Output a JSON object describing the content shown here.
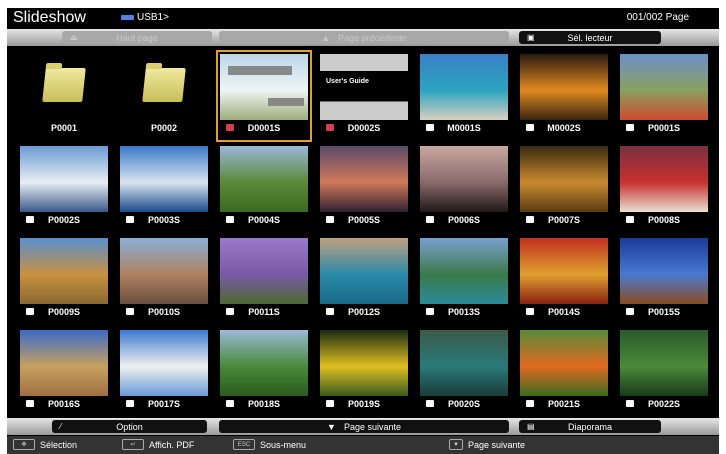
{
  "header": {
    "title": "Slideshow",
    "path": "USB1>",
    "page": "001/002 Page"
  },
  "top_toolbar": {
    "top_page": "Haut page",
    "prev_page": "Page précédente",
    "select_reader": "Sél. lecteur"
  },
  "bottom_toolbar": {
    "option": "Option",
    "next_page": "Page suivante",
    "slideshow": "Diaporama"
  },
  "hints": [
    {
      "key": "✥",
      "label": "Sélection"
    },
    {
      "key": "↵",
      "label": "Affich. PDF"
    },
    {
      "key": "ESC",
      "label": "Sous-menu"
    },
    {
      "key": "▼",
      "label": "Page suivante"
    }
  ],
  "pdf_thumb_text": "User's Guide",
  "selected": "D0001S",
  "tiles": [
    {
      "name": "P0001",
      "type": "folder"
    },
    {
      "name": "P0002",
      "type": "folder"
    },
    {
      "name": "D0001S",
      "type": "pdf",
      "colors": [
        "#bcd6ea",
        "#eef3f5",
        "#9eae7a"
      ]
    },
    {
      "name": "D0002S",
      "type": "pdf2"
    },
    {
      "name": "M0001S",
      "type": "movie",
      "colors": [
        "#3b7fc6",
        "#2aa5c0",
        "#d8d0c0"
      ]
    },
    {
      "name": "M0002S",
      "type": "movie",
      "colors": [
        "#2a1a10",
        "#e08a20",
        "#3a2410"
      ]
    },
    {
      "name": "P0001S",
      "type": "photo",
      "colors": [
        "#6a90c8",
        "#8aa060",
        "#d04a30"
      ]
    },
    {
      "name": "P0002S",
      "type": "photo",
      "colors": [
        "#6a9ad0",
        "#e8eef4",
        "#3a5a8a"
      ]
    },
    {
      "name": "P0003S",
      "type": "photo",
      "colors": [
        "#3a78c8",
        "#d8e4f0",
        "#1a4a8a"
      ]
    },
    {
      "name": "P0004S",
      "type": "photo",
      "colors": [
        "#9ab8d8",
        "#5a8a3a",
        "#3a6a20"
      ]
    },
    {
      "name": "P0005S",
      "type": "photo",
      "colors": [
        "#5a4a6a",
        "#d07a5a",
        "#302030"
      ]
    },
    {
      "name": "P0006S",
      "type": "photo",
      "colors": [
        "#c8a8a0",
        "#8a6a6a",
        "#201818"
      ]
    },
    {
      "name": "P0007S",
      "type": "photo",
      "colors": [
        "#3a2a10",
        "#c88a30",
        "#5a3a10"
      ]
    },
    {
      "name": "P0008S",
      "type": "photo",
      "colors": [
        "#7a3040",
        "#c83030",
        "#e8e0d0"
      ]
    },
    {
      "name": "P0009S",
      "type": "photo",
      "colors": [
        "#5a90d0",
        "#c89040",
        "#8a6a30"
      ]
    },
    {
      "name": "P0010S",
      "type": "photo",
      "colors": [
        "#8ab0d8",
        "#b08060",
        "#6a5040"
      ]
    },
    {
      "name": "P0011S",
      "type": "photo",
      "colors": [
        "#9a7ac8",
        "#7a5aa8",
        "#4a6a30"
      ]
    },
    {
      "name": "P0012S",
      "type": "photo",
      "colors": [
        "#c0a080",
        "#2a8aa8",
        "#1a6a8a"
      ]
    },
    {
      "name": "P0013S",
      "type": "photo",
      "colors": [
        "#7aa0d0",
        "#3a7a4a",
        "#2a8a9a"
      ]
    },
    {
      "name": "P0014S",
      "type": "photo",
      "colors": [
        "#c03020",
        "#e0a030",
        "#8a2010"
      ]
    },
    {
      "name": "P0015S",
      "type": "photo",
      "colors": [
        "#1a3a9a",
        "#4a7ad0",
        "#8a4a20"
      ]
    },
    {
      "name": "P0016S",
      "type": "photo",
      "colors": [
        "#3a6ac8",
        "#c8a060",
        "#a07040"
      ]
    },
    {
      "name": "P0017S",
      "type": "photo",
      "colors": [
        "#3a7ad0",
        "#f0f0f0",
        "#6a9ad8"
      ]
    },
    {
      "name": "P0018S",
      "type": "photo",
      "colors": [
        "#9ab8d8",
        "#4a8a3a",
        "#2a5a20"
      ]
    },
    {
      "name": "P0019S",
      "type": "photo",
      "colors": [
        "#1a2a10",
        "#e0c020",
        "#3a5a20"
      ]
    },
    {
      "name": "P0020S",
      "type": "photo",
      "colors": [
        "#3a5a4a",
        "#2a7a7a",
        "#1a3a3a"
      ]
    },
    {
      "name": "P0021S",
      "type": "photo",
      "colors": [
        "#5a8a3a",
        "#e06a20",
        "#3a6a20"
      ]
    },
    {
      "name": "P0022S",
      "type": "photo",
      "colors": [
        "#2a5a2a",
        "#4a8a3a",
        "#1a3a1a"
      ]
    }
  ],
  "colors": {
    "selection": "#e0a030",
    "accent_blue": "#5a7fe0"
  }
}
